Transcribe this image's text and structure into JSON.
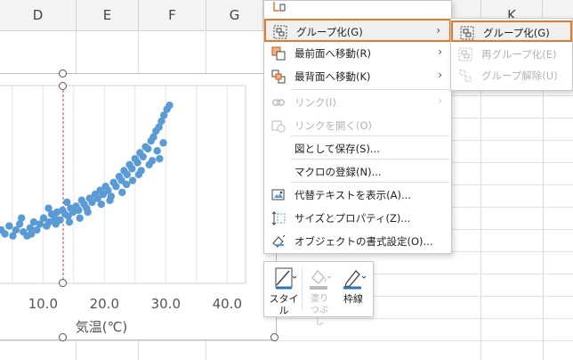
{
  "spreadsheet": {
    "columns": [
      "D",
      "E",
      "F",
      "G",
      "K"
    ]
  },
  "chart_data": {
    "type": "scatter",
    "xlabel": "気温(℃)",
    "x_ticks": [
      "10.0",
      "20.0",
      "30.0",
      "40.0"
    ],
    "xlim": [
      3,
      43
    ],
    "ylim": [
      0,
      100
    ],
    "series": [
      {
        "color": "#5b9bd5",
        "points": [
          [
            3.2,
            27
          ],
          [
            3.8,
            25
          ],
          [
            4.5,
            29
          ],
          [
            5.1,
            24
          ],
          [
            5.6,
            27
          ],
          [
            6.2,
            30
          ],
          [
            6.8,
            26
          ],
          [
            7.4,
            24
          ],
          [
            7.9,
            28
          ],
          [
            8.5,
            31
          ],
          [
            9.0,
            27
          ],
          [
            9.5,
            30
          ],
          [
            10.1,
            33
          ],
          [
            10.6,
            29
          ],
          [
            11.0,
            31
          ],
          [
            11.4,
            35
          ],
          [
            11.9,
            33
          ],
          [
            12.3,
            36
          ],
          [
            12.8,
            32
          ],
          [
            13.2,
            37
          ],
          [
            13.6,
            35
          ],
          [
            14.1,
            34
          ],
          [
            14.5,
            38
          ],
          [
            14.9,
            36
          ],
          [
            15.4,
            39
          ],
          [
            15.8,
            37
          ],
          [
            16.3,
            42
          ],
          [
            16.7,
            40
          ],
          [
            17.1,
            38
          ],
          [
            17.6,
            43
          ],
          [
            18.0,
            41
          ],
          [
            18.5,
            45
          ],
          [
            18.9,
            43
          ],
          [
            19.3,
            47
          ],
          [
            19.8,
            45
          ],
          [
            20.2,
            49
          ],
          [
            20.6,
            47
          ],
          [
            21.1,
            44
          ],
          [
            21.5,
            51
          ],
          [
            21.9,
            49
          ],
          [
            22.4,
            54
          ],
          [
            22.8,
            52
          ],
          [
            23.2,
            57
          ],
          [
            23.7,
            55
          ],
          [
            24.1,
            60
          ],
          [
            24.5,
            58
          ],
          [
            25.0,
            63
          ],
          [
            25.4,
            61
          ],
          [
            25.8,
            66
          ],
          [
            26.3,
            64
          ],
          [
            26.7,
            69
          ],
          [
            27.1,
            68
          ],
          [
            27.6,
            72
          ],
          [
            28.0,
            74
          ],
          [
            28.4,
            77
          ],
          [
            28.9,
            79
          ],
          [
            29.3,
            82
          ],
          [
            29.7,
            85
          ],
          [
            30.2,
            88
          ],
          [
            30.6,
            90
          ],
          [
            12.1,
            30
          ],
          [
            16.0,
            33
          ],
          [
            19.5,
            40
          ],
          [
            22.9,
            46
          ],
          [
            24.6,
            52
          ],
          [
            26.0,
            57
          ],
          [
            27.8,
            62
          ],
          [
            28.6,
            67
          ],
          [
            29.6,
            71
          ],
          [
            17.3,
            36
          ],
          [
            14.3,
            31
          ],
          [
            20.9,
            42
          ],
          [
            23.6,
            50
          ],
          [
            25.6,
            55
          ],
          [
            27.3,
            60
          ],
          [
            29.0,
            63
          ],
          [
            8.1,
            25
          ],
          [
            6.5,
            33
          ],
          [
            10.9,
            38
          ],
          [
            13.9,
            41
          ]
        ]
      }
    ]
  },
  "context_menu": {
    "items": [
      {
        "label": "",
        "icon": "partial-icon",
        "type": "partial"
      },
      {
        "label": "グループ化(G)",
        "icon": "group-icon",
        "arrow": "›",
        "disabled": false,
        "highlighted": true
      },
      {
        "label": "最前面へ移動(R)",
        "icon": "bring-to-front-icon",
        "arrow": "›",
        "disabled": false
      },
      {
        "label": "最背面へ移動(K)",
        "icon": "send-to-back-icon",
        "arrow": "›",
        "disabled": false
      },
      {
        "label": "リンク(I)",
        "icon": "link-icon",
        "arrow": "›",
        "disabled": true
      },
      {
        "label": "リンクを開く(O)",
        "icon": "open-link-icon",
        "disabled": true
      },
      {
        "label": "図として保存(S)...",
        "icon": "",
        "disabled": false
      },
      {
        "label": "マクロの登録(N)...",
        "icon": "",
        "disabled": false
      },
      {
        "label": "代替テキストを表示(A)...",
        "icon": "alt-text-icon",
        "disabled": false
      },
      {
        "label": "サイズとプロパティ(Z)...",
        "icon": "size-properties-icon",
        "disabled": false
      },
      {
        "label": "オブジェクトの書式設定(O)...",
        "icon": "format-object-icon",
        "disabled": false
      }
    ]
  },
  "sub_menu": {
    "items": [
      {
        "label": "グループ化(G)",
        "icon": "group-icon",
        "disabled": false,
        "highlighted": true
      },
      {
        "label": "再グループ化(E)",
        "icon": "regroup-icon",
        "disabled": true
      },
      {
        "label": "グループ解除(U)",
        "icon": "ungroup-icon",
        "disabled": true
      }
    ]
  },
  "mini_toolbar": {
    "style_label": "スタイル",
    "fill_label": "塗りつぶし",
    "outline_label": "枠線"
  },
  "colors": {
    "accent_highlight": "#e8792b",
    "marker": "#5b9bd5",
    "guide_line": "#e0383b"
  }
}
